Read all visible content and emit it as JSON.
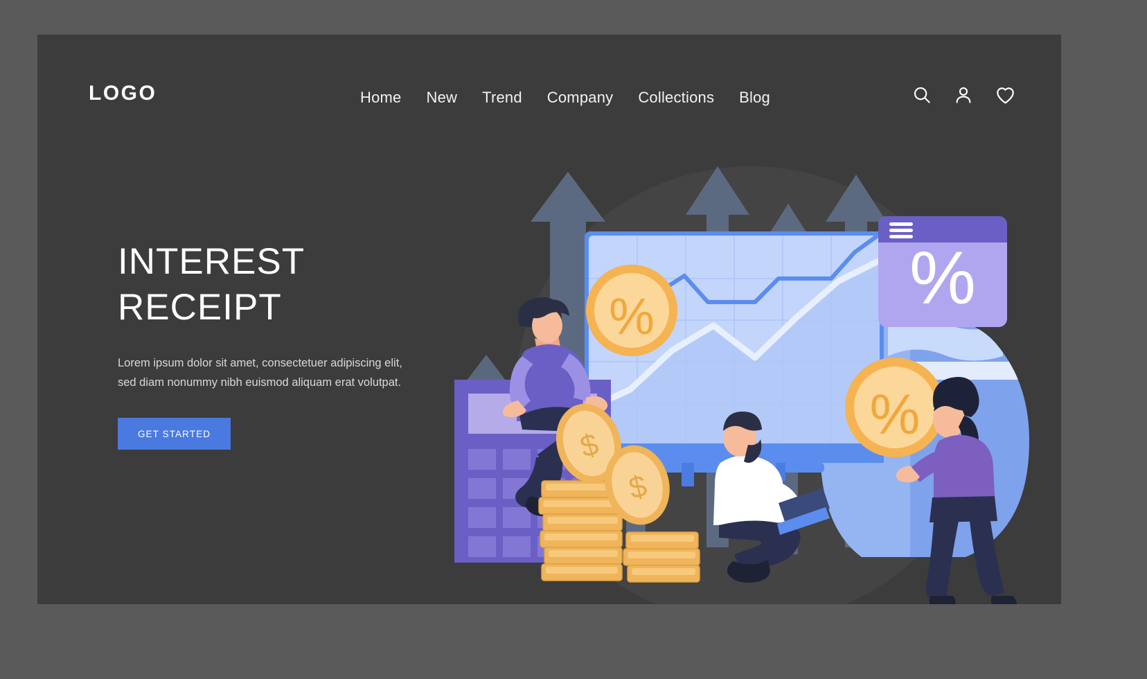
{
  "page": {
    "background_outer": "#5a5a5a",
    "background_card": "#3c3c3c"
  },
  "header": {
    "logo": "LOGO",
    "nav_items": [
      {
        "label": "Home"
      },
      {
        "label": "New"
      },
      {
        "label": "Trend"
      },
      {
        "label": "Company"
      },
      {
        "label": "Collections"
      },
      {
        "label": "Blog"
      }
    ],
    "icons": [
      {
        "name": "search-icon"
      },
      {
        "name": "user-icon"
      },
      {
        "name": "heart-icon"
      }
    ]
  },
  "hero": {
    "headline_line1": "INTEREST",
    "headline_line2": "RECEIPT",
    "paragraph": "Lorem ipsum dolor sit amet, consectetuer adipiscing elit, sed diam nonummy nibh euismod aliquam erat volutpat.",
    "cta_label": "GET STARTED",
    "cta_color": "#4a7ae0"
  },
  "illustration": {
    "name": "interest-receipt-illustration",
    "description": "Flat illustration of finance growth: upward arrows, a purple calculator with a man holding a percent coin, stacks of gold dollar coins, a bearded man with a laptop, a monitor with line and area charts, a percent browser card, a woman holding a percent coin and a money bag.",
    "elements": [
      {
        "name": "growth-arrows",
        "color": "#5b6a80",
        "count": 6
      },
      {
        "name": "calculator",
        "color": "#6a5fc4"
      },
      {
        "name": "percent-coin-large",
        "color": "#f2c57c"
      },
      {
        "name": "coin-stacks",
        "color": "#f0b45a"
      },
      {
        "name": "dollar-coin",
        "symbol": "$",
        "color": "#f5cf8b"
      },
      {
        "name": "monitor-chart",
        "color": "#b9cefa"
      },
      {
        "name": "percent-card",
        "color": "#b0a6f0",
        "symbol": "%"
      },
      {
        "name": "money-bag",
        "color": "#88a9ef"
      },
      {
        "name": "person-on-calculator",
        "shirt": "#6a5fc4"
      },
      {
        "name": "person-with-laptop",
        "shirt": "#ffffff"
      },
      {
        "name": "person-with-coin",
        "shirt": "#7d5fc0"
      }
    ],
    "chart": {
      "type": "line",
      "series_line_color": "#5b8def",
      "area_color": "#ffffff",
      "grid": true
    }
  }
}
